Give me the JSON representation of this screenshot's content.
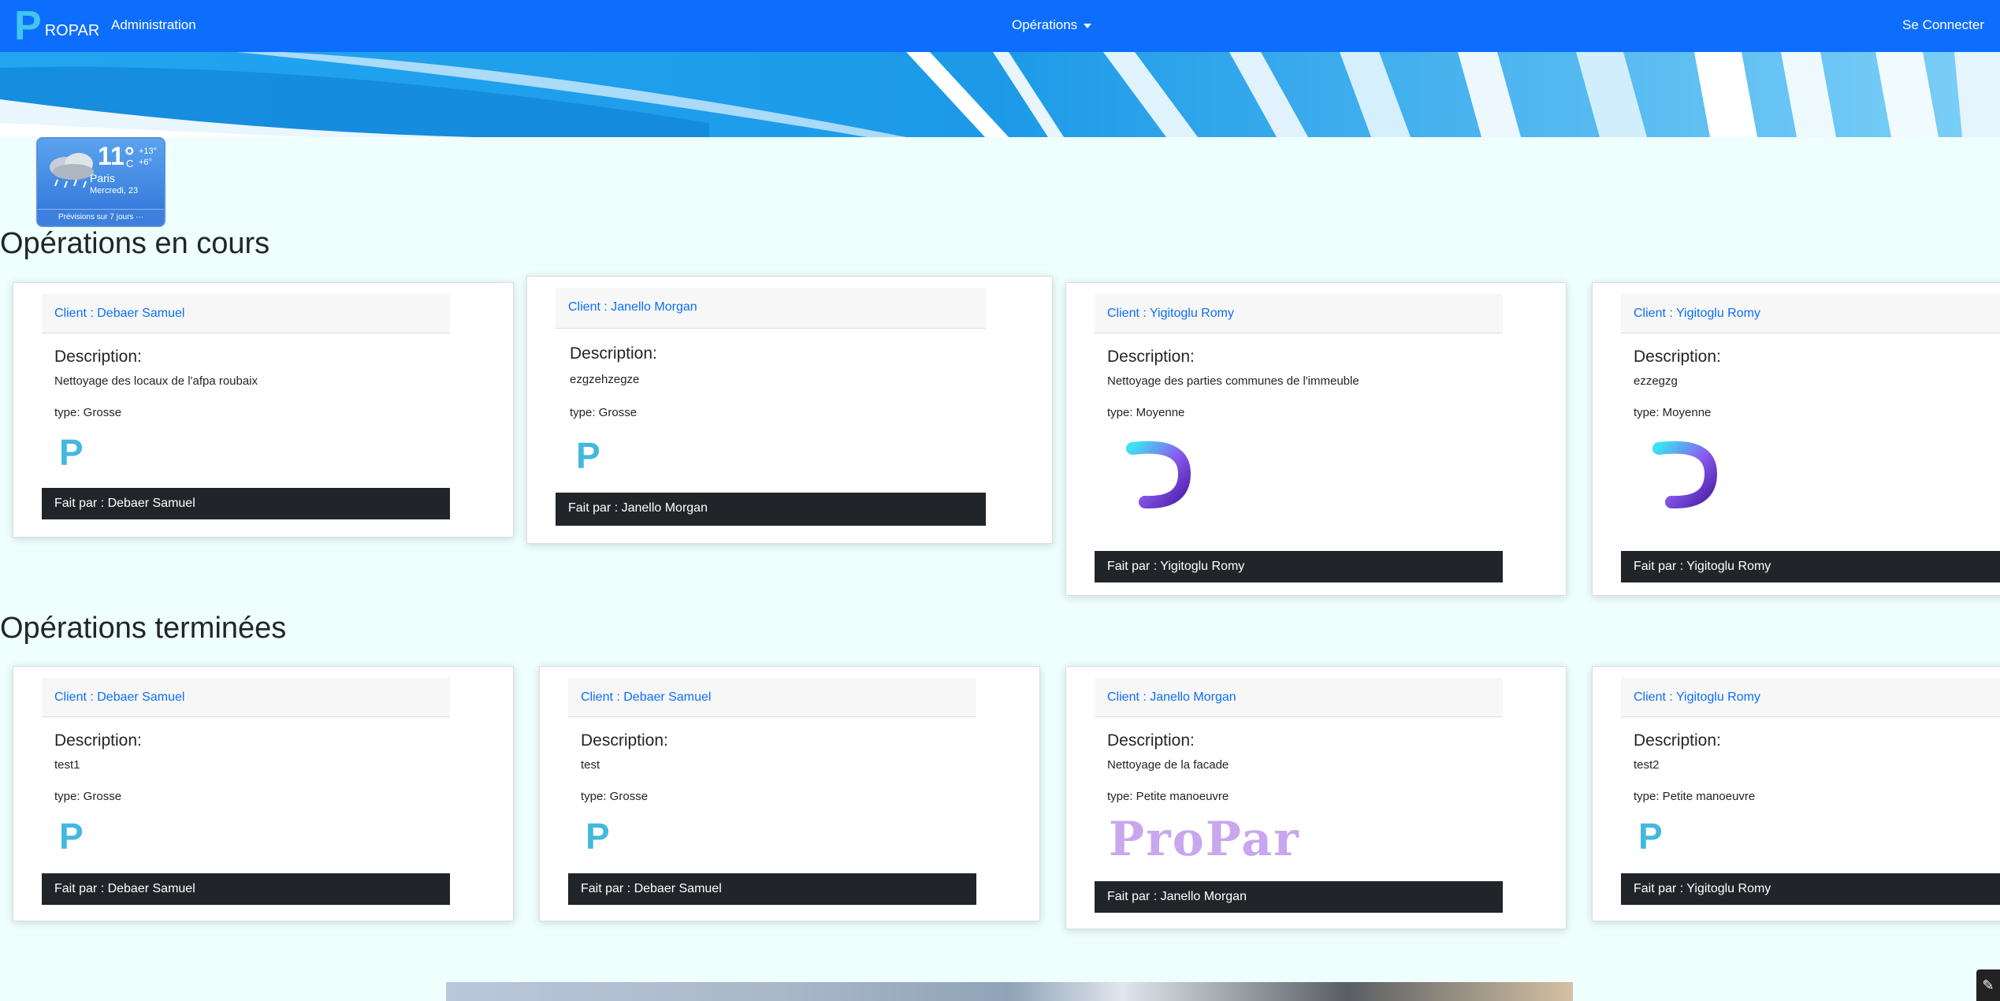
{
  "nav": {
    "brand_letter": "P",
    "brand_text": "ROPAR",
    "admin": "Administration",
    "operations": "Opérations",
    "login": "Se Connecter"
  },
  "weather": {
    "temp": "11°",
    "unit": "C",
    "hi": "+13°",
    "lo": "+6°",
    "city": "Paris",
    "date": "Mercredi, 23",
    "forecast": "Prévisions sur 7 jours ···"
  },
  "sections": {
    "current": "Opérations en cours",
    "done": "Opérations terminées"
  },
  "labels": {
    "description": "Description:"
  },
  "current_cards": [
    {
      "client": "Client : Debaer Samuel",
      "description": "Nettoyage des locaux de l'afpa roubaix",
      "type": "type: Grosse",
      "done_by": "Fait par : Debaer Samuel"
    },
    {
      "client": "Client : Janello Morgan",
      "description": "ezgzehzegze",
      "type": "type: Grosse",
      "done_by": "Fait par : Janello Morgan"
    },
    {
      "client": "Client : Yigitoglu Romy",
      "description": "Nettoyage des parties communes de l'immeuble",
      "type": "type: Moyenne",
      "done_by": "Fait par : Yigitoglu Romy"
    },
    {
      "client": "Client : Yigitoglu Romy",
      "description": "ezzegzg",
      "type": "type: Moyenne",
      "done_by": "Fait par : Yigitoglu Romy"
    }
  ],
  "done_cards": [
    {
      "client": "Client : Debaer Samuel",
      "description": "test1",
      "type": "type: Grosse",
      "done_by": "Fait par : Debaer Samuel"
    },
    {
      "client": "Client : Debaer Samuel",
      "description": "test",
      "type": "type: Grosse",
      "done_by": "Fait par : Debaer Samuel"
    },
    {
      "client": "Client : Janello Morgan",
      "description": "Nettoyage de la facade",
      "type": "type: Petite manoeuvre",
      "done_by": "Fait par : Janello Morgan"
    },
    {
      "client": "Client : Yigitoglu Romy",
      "description": "test2",
      "type": "type: Petite manoeuvre",
      "done_by": "Fait par : Yigitoglu Romy"
    }
  ],
  "logos": {
    "p": "P",
    "propar_word": "ProPar"
  },
  "colors": {
    "navbar": "#0d6efd",
    "page_bg": "#eefffe",
    "footer_bar": "#212529",
    "client_link": "#0d6efd"
  }
}
